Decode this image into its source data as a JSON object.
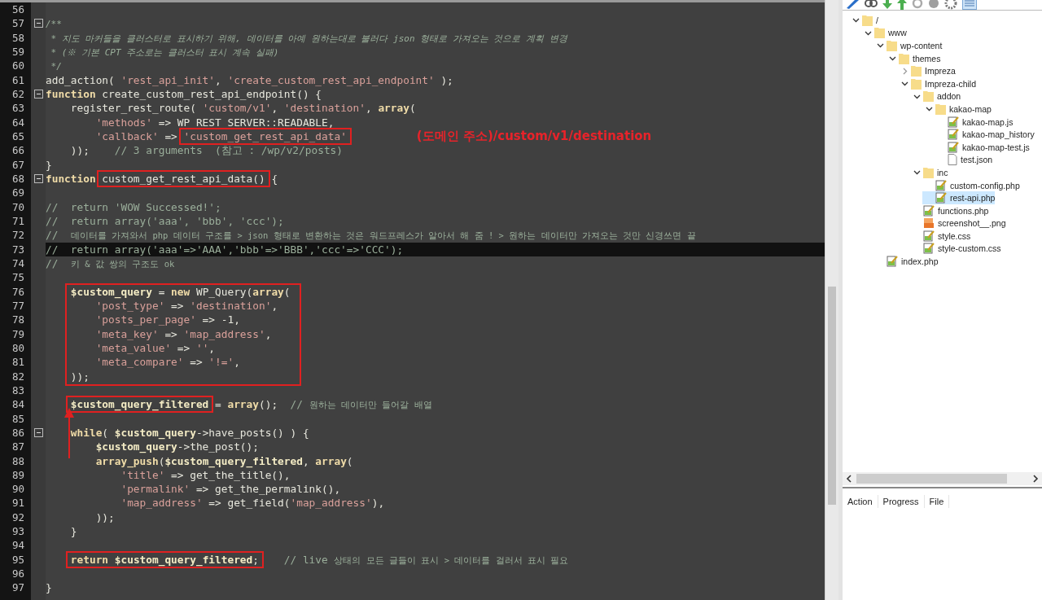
{
  "editor": {
    "lines": [
      {
        "kind": "line",
        "number": "56",
        "current": false,
        "fold": false
      },
      {
        "kind": "line",
        "number": "57",
        "current": false,
        "fold": true,
        "tokens": [
          {
            "kind": "doc",
            "text": "/**"
          }
        ]
      },
      {
        "kind": "line",
        "number": "58",
        "current": false,
        "fold": false,
        "tokens": [
          {
            "kind": "doc",
            "text": " * 지도 마커들을 클러스터로 표시하기 위해, 데이터를 아예 원하는대로 불러다 json 형태로 가져오는 것으로 계획 변경"
          }
        ]
      },
      {
        "kind": "line",
        "number": "59",
        "current": false,
        "fold": false,
        "tokens": [
          {
            "kind": "doc",
            "text": " * (※ 기본 CPT 주소로는 클러스터 표시 계속 실패)"
          }
        ]
      },
      {
        "kind": "line",
        "number": "60",
        "current": false,
        "fold": false,
        "tokens": [
          {
            "kind": "doc",
            "text": " */"
          }
        ]
      },
      {
        "kind": "line",
        "number": "61",
        "current": false,
        "fold": false,
        "tokens": [
          {
            "kind": "plain",
            "text": "add_action( "
          },
          {
            "kind": "string",
            "text": "'rest_api_init'"
          },
          {
            "kind": "plain",
            "text": ", "
          },
          {
            "kind": "string",
            "text": "'create_custom_rest_api_endpoint'"
          },
          {
            "kind": "plain",
            "text": " );"
          }
        ]
      },
      {
        "kind": "line",
        "number": "62",
        "current": false,
        "fold": true,
        "tokens": [
          {
            "kind": "keyword",
            "text": "function"
          },
          {
            "kind": "plain",
            "text": " create_custom_rest_api_endpoint() {"
          }
        ]
      },
      {
        "kind": "line",
        "number": "63",
        "current": false,
        "fold": false,
        "tokens": [
          {
            "kind": "plain",
            "text": "    register_rest_route( "
          },
          {
            "kind": "string",
            "text": "'custom/v1'"
          },
          {
            "kind": "plain",
            "text": ", "
          },
          {
            "kind": "string",
            "text": "'destination'"
          },
          {
            "kind": "plain",
            "text": ", "
          },
          {
            "kind": "keyword",
            "text": "array"
          },
          {
            "kind": "plain",
            "text": "("
          }
        ]
      },
      {
        "kind": "line",
        "number": "64",
        "current": false,
        "fold": false,
        "tokens": [
          {
            "kind": "string",
            "text": "        'methods'"
          },
          {
            "kind": "plain",
            "text": " => WP_REST_SERVER::READABLE,"
          }
        ]
      },
      {
        "kind": "line",
        "number": "65",
        "current": false,
        "fold": false,
        "tokens": [
          {
            "kind": "string",
            "text": "        'callback'"
          },
          {
            "kind": "plain",
            "text": " => "
          },
          {
            "kind": "boxed",
            "arrow": false,
            "tokens": [
              {
                "kind": "string",
                "text": "'custom_get_rest_api_data'"
              }
            ]
          },
          {
            "kind": "note",
            "text": "(도메인 주소)/custom/v1/destination"
          }
        ]
      },
      {
        "kind": "line",
        "number": "66",
        "current": false,
        "fold": false,
        "tokens": [
          {
            "kind": "plain",
            "text": "    ));    "
          },
          {
            "kind": "comment",
            "text": "// 3 arguments  (참고 : /wp/v2/posts)"
          }
        ]
      },
      {
        "kind": "line",
        "number": "67",
        "current": false,
        "fold": false,
        "tokens": [
          {
            "kind": "plain",
            "text": "}"
          }
        ]
      },
      {
        "kind": "line",
        "number": "68",
        "current": false,
        "fold": true,
        "tokens": [
          {
            "kind": "keyword",
            "text": "function "
          },
          {
            "kind": "boxed",
            "arrow": false,
            "tokens": [
              {
                "kind": "plain",
                "text": "custom_get_rest_api_data()"
              }
            ]
          },
          {
            "kind": "plain",
            "text": " {"
          }
        ]
      },
      {
        "kind": "line",
        "number": "69",
        "current": false,
        "fold": false
      },
      {
        "kind": "line",
        "number": "70",
        "current": false,
        "fold": false,
        "tokens": [
          {
            "kind": "comment",
            "text": "//  return 'WOW Successed!';"
          }
        ]
      },
      {
        "kind": "line",
        "number": "71",
        "current": false,
        "fold": false,
        "tokens": [
          {
            "kind": "comment",
            "text": "//  return array('aaa', 'bbb', 'ccc');"
          }
        ]
      },
      {
        "kind": "line",
        "number": "72",
        "current": false,
        "fold": false,
        "tokens": [
          {
            "kind": "comment",
            "text": "//  "
          },
          {
            "kind": "comment-small",
            "text": "데이터를 가져와서 php 데이터 구조를 > json 형태로 변환하는 것은 워드프레스가 알아서 해 줌 ! > 원하는 데이터만 가져오는 것만 신경쓰면 끝"
          }
        ]
      },
      {
        "kind": "line",
        "number": "73",
        "current": true,
        "fold": false,
        "tokens": [
          {
            "kind": "comment",
            "text": "//  return array('aaa'=>'AAA','bbb'=>'BBB','ccc'=>'CCC');"
          }
        ]
      },
      {
        "kind": "line",
        "number": "74",
        "current": false,
        "fold": false,
        "tokens": [
          {
            "kind": "comment",
            "text": "//  "
          },
          {
            "kind": "comment-small",
            "text": "키 & 값 쌍의 구조도 ok"
          }
        ]
      },
      {
        "kind": "line",
        "number": "75",
        "current": false,
        "fold": false
      },
      {
        "kind": "boxed-group",
        "lines": [
          {
            "kind": "line",
            "number": "76",
            "current": false,
            "fold": false,
            "tokens": [
              {
                "kind": "var",
                "text": "    $custom_query"
              },
              {
                "kind": "plain",
                "text": " = "
              },
              {
                "kind": "keyword",
                "text": "new"
              },
              {
                "kind": "plain",
                "text": " WP_Query("
              },
              {
                "kind": "keyword",
                "text": "array"
              },
              {
                "kind": "plain",
                "text": "("
              }
            ]
          },
          {
            "kind": "line",
            "number": "77",
            "current": false,
            "fold": false,
            "tokens": [
              {
                "kind": "string",
                "text": "        'post_type'"
              },
              {
                "kind": "plain",
                "text": " => "
              },
              {
                "kind": "string",
                "text": "'destination'"
              },
              {
                "kind": "plain",
                "text": ","
              }
            ]
          },
          {
            "kind": "line",
            "number": "78",
            "current": false,
            "fold": false,
            "tokens": [
              {
                "kind": "string",
                "text": "        'posts_per_page'"
              },
              {
                "kind": "plain",
                "text": " => -1,"
              }
            ]
          },
          {
            "kind": "line",
            "number": "79",
            "current": false,
            "fold": false,
            "tokens": [
              {
                "kind": "string",
                "text": "        'meta_key'"
              },
              {
                "kind": "plain",
                "text": " => "
              },
              {
                "kind": "string",
                "text": "'map_address'"
              },
              {
                "kind": "plain",
                "text": ","
              }
            ]
          },
          {
            "kind": "line",
            "number": "80",
            "current": false,
            "fold": false,
            "tokens": [
              {
                "kind": "string",
                "text": "        'meta_value'"
              },
              {
                "kind": "plain",
                "text": " => "
              },
              {
                "kind": "string",
                "text": "''"
              },
              {
                "kind": "plain",
                "text": ","
              }
            ]
          },
          {
            "kind": "line",
            "number": "81",
            "current": false,
            "fold": false,
            "tokens": [
              {
                "kind": "string",
                "text": "        'meta_compare'"
              },
              {
                "kind": "plain",
                "text": " => "
              },
              {
                "kind": "string",
                "text": "'!='"
              },
              {
                "kind": "plain",
                "text": ","
              }
            ]
          },
          {
            "kind": "line",
            "number": "82",
            "current": false,
            "fold": false,
            "tokens": [
              {
                "kind": "plain",
                "text": "    ));"
              }
            ]
          }
        ]
      },
      {
        "kind": "line",
        "number": "83",
        "current": false,
        "fold": false
      },
      {
        "kind": "line",
        "number": "84",
        "current": false,
        "fold": false,
        "tokens": [
          {
            "kind": "boxed",
            "arrow": true,
            "tokens": [
              {
                "kind": "var",
                "text": "    $custom_query_filtered"
              }
            ]
          },
          {
            "kind": "plain",
            "text": " = "
          },
          {
            "kind": "keyword",
            "text": "array"
          },
          {
            "kind": "plain",
            "text": "();  "
          },
          {
            "kind": "comment",
            "text": "// "
          },
          {
            "kind": "comment-small",
            "text": "원하는 데이터만 들어갈 배열"
          }
        ]
      },
      {
        "kind": "line",
        "number": "85",
        "current": false,
        "fold": false
      },
      {
        "kind": "line",
        "number": "86",
        "current": false,
        "fold": true,
        "tokens": [
          {
            "kind": "keyword",
            "text": "    while"
          },
          {
            "kind": "plain",
            "text": "( "
          },
          {
            "kind": "var",
            "text": "$custom_query"
          },
          {
            "kind": "plain",
            "text": "->have_posts() ) {"
          }
        ]
      },
      {
        "kind": "line",
        "number": "87",
        "current": false,
        "fold": false,
        "tokens": [
          {
            "kind": "var",
            "text": "        $custom_query"
          },
          {
            "kind": "plain",
            "text": "->the_post();"
          }
        ]
      },
      {
        "kind": "line",
        "number": "88",
        "current": false,
        "fold": false,
        "tokens": [
          {
            "kind": "keyword",
            "text": "        array_push"
          },
          {
            "kind": "plain",
            "text": "("
          },
          {
            "kind": "var",
            "text": "$custom_query_filtered"
          },
          {
            "kind": "plain",
            "text": ", "
          },
          {
            "kind": "keyword",
            "text": "array"
          },
          {
            "kind": "plain",
            "text": "("
          }
        ]
      },
      {
        "kind": "line",
        "number": "89",
        "current": false,
        "fold": false,
        "tokens": [
          {
            "kind": "string",
            "text": "            'title'"
          },
          {
            "kind": "plain",
            "text": " => get_the_title(),"
          }
        ]
      },
      {
        "kind": "line",
        "number": "90",
        "current": false,
        "fold": false,
        "tokens": [
          {
            "kind": "string",
            "text": "            'permalink'"
          },
          {
            "kind": "plain",
            "text": " => get_the_permalink(),"
          }
        ]
      },
      {
        "kind": "line",
        "number": "91",
        "current": false,
        "fold": false,
        "tokens": [
          {
            "kind": "string",
            "text": "            'map_address'"
          },
          {
            "kind": "plain",
            "text": " => get_field("
          },
          {
            "kind": "string",
            "text": "'map_address'"
          },
          {
            "kind": "plain",
            "text": "),"
          }
        ]
      },
      {
        "kind": "line",
        "number": "92",
        "current": false,
        "fold": false,
        "tokens": [
          {
            "kind": "plain",
            "text": "        ));"
          }
        ]
      },
      {
        "kind": "line",
        "number": "93",
        "current": false,
        "fold": false,
        "tokens": [
          {
            "kind": "plain",
            "text": "    }"
          }
        ]
      },
      {
        "kind": "line",
        "number": "94",
        "current": false,
        "fold": false
      },
      {
        "kind": "line",
        "number": "95",
        "current": false,
        "fold": false,
        "tokens": [
          {
            "kind": "boxed",
            "arrow": false,
            "tokens": [
              {
                "kind": "keyword",
                "text": "    return"
              },
              {
                "kind": "var",
                "text": " $custom_query_filtered"
              },
              {
                "kind": "plain",
                "text": ";"
              }
            ]
          },
          {
            "kind": "comment",
            "text": "    // live "
          },
          {
            "kind": "comment-small",
            "text": "상태의 모든 글들이 표시 > 데이터를 걸러서 표시 필요"
          }
        ]
      },
      {
        "kind": "line",
        "number": "96",
        "current": false,
        "fold": false
      },
      {
        "kind": "line",
        "number": "97",
        "current": false,
        "fold": false,
        "tokens": [
          {
            "kind": "plain",
            "text": "}"
          }
        ]
      }
    ]
  },
  "file_tree": [
    {
      "label": "/",
      "kind": "folder",
      "expanded": true,
      "selected": false,
      "children": [
        {
          "label": "www",
          "kind": "folder",
          "expanded": true,
          "selected": false,
          "children": [
            {
              "label": "wp-content",
              "kind": "folder",
              "expanded": true,
              "selected": false,
              "children": [
                {
                  "label": "themes",
                  "kind": "folder",
                  "expanded": true,
                  "selected": false,
                  "children": [
                    {
                      "label": "Impreza",
                      "kind": "folder",
                      "expanded": false,
                      "selected": false
                    },
                    {
                      "label": "Impreza-child",
                      "kind": "folder",
                      "expanded": true,
                      "selected": false,
                      "children": [
                        {
                          "label": "addon",
                          "kind": "folder",
                          "expanded": true,
                          "selected": false,
                          "children": [
                            {
                              "label": "kakao-map",
                              "kind": "folder",
                              "expanded": true,
                              "selected": false,
                              "children": [
                                {
                                  "label": "kakao-map.js",
                                  "kind": "script",
                                  "selected": false
                                },
                                {
                                  "label": "kakao-map_history",
                                  "kind": "script",
                                  "selected": false
                                },
                                {
                                  "label": "kakao-map-test.js",
                                  "kind": "script",
                                  "selected": false
                                },
                                {
                                  "label": "test.json",
                                  "kind": "file",
                                  "selected": false
                                }
                              ]
                            }
                          ]
                        },
                        {
                          "label": "inc",
                          "kind": "folder",
                          "expanded": true,
                          "selected": false,
                          "children": [
                            {
                              "label": "custom-config.php",
                              "kind": "script",
                              "selected": false
                            },
                            {
                              "label": "rest-api.php",
                              "kind": "script",
                              "selected": true
                            }
                          ]
                        },
                        {
                          "label": "functions.php",
                          "kind": "script",
                          "selected": false
                        },
                        {
                          "label": "screenshot__.png",
                          "kind": "image",
                          "selected": false
                        },
                        {
                          "label": "style.css",
                          "kind": "script",
                          "selected": false
                        },
                        {
                          "label": "style-custom.css",
                          "kind": "script",
                          "selected": false
                        }
                      ]
                    }
                  ]
                }
              ]
            },
            {
              "label": "index.php",
              "kind": "script",
              "selected": false
            }
          ]
        }
      ]
    }
  ],
  "transfer_queue": {
    "columns": [
      "Action",
      "Progress",
      "File"
    ]
  }
}
